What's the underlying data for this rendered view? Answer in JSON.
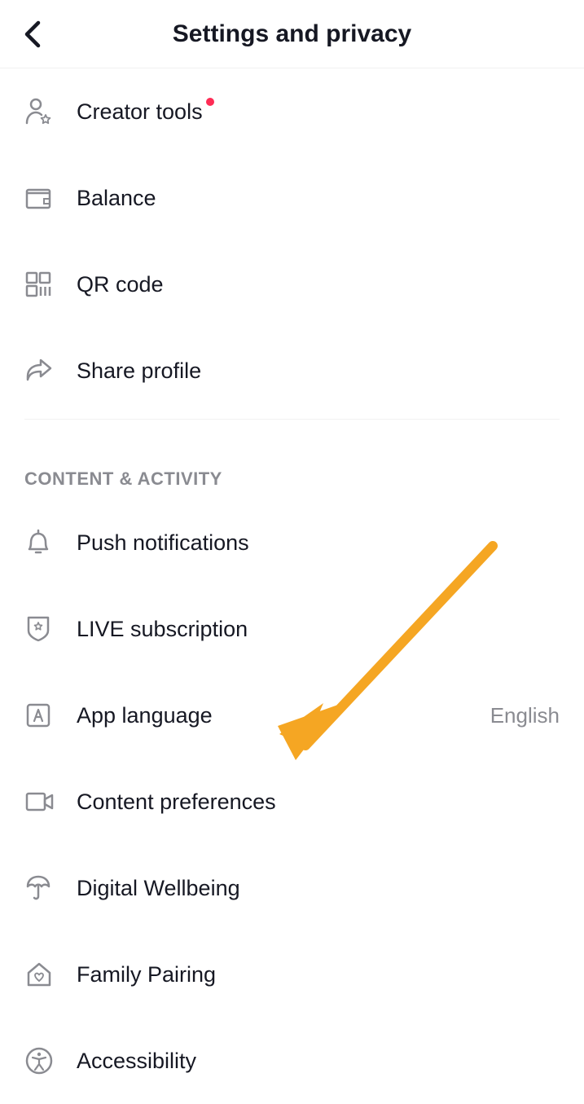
{
  "header": {
    "title": "Settings and privacy"
  },
  "items": [
    {
      "label": "Creator tools",
      "dot": true
    },
    {
      "label": "Balance"
    },
    {
      "label": "QR code"
    },
    {
      "label": "Share profile"
    }
  ],
  "section2": {
    "heading": "CONTENT & ACTIVITY",
    "items": [
      {
        "label": "Push notifications"
      },
      {
        "label": "LIVE subscription"
      },
      {
        "label": "App language",
        "value": "English"
      },
      {
        "label": "Content preferences"
      },
      {
        "label": "Digital Wellbeing"
      },
      {
        "label": "Family Pairing"
      },
      {
        "label": "Accessibility"
      }
    ]
  }
}
